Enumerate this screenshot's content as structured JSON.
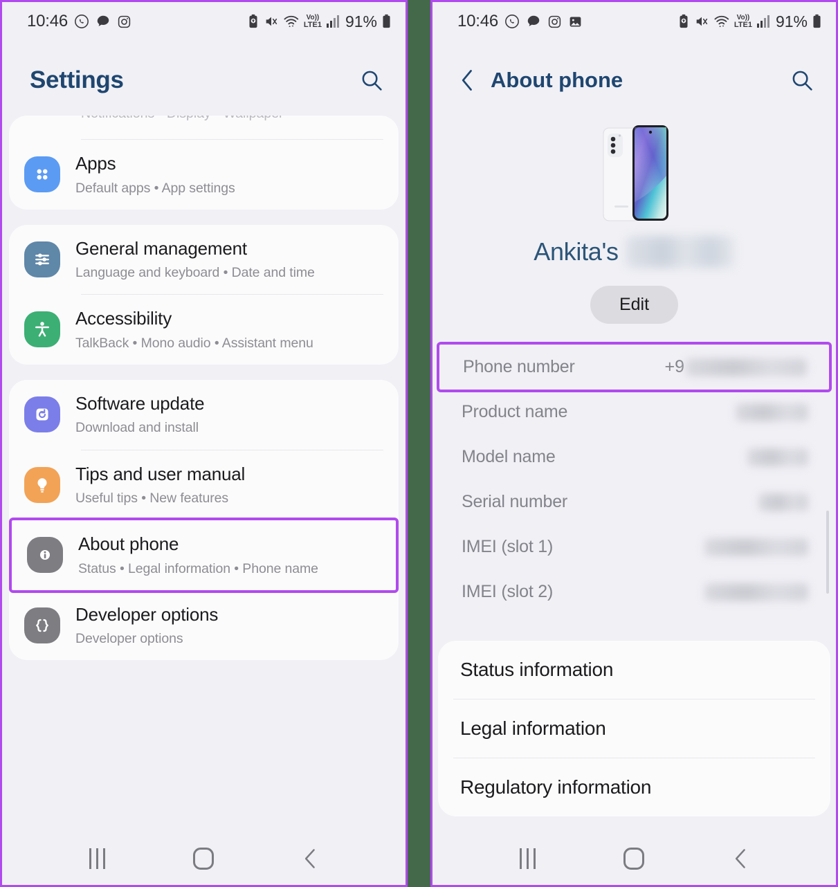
{
  "statusbar": {
    "time": "10:46",
    "battery_percent": "91%",
    "left_icons": [
      "whatsapp-icon",
      "chat-bubble-icon",
      "instagram-icon"
    ],
    "left_icons_right_panel": [
      "whatsapp-icon",
      "chat-bubble-icon",
      "instagram-icon",
      "gallery-icon"
    ],
    "right_icons": [
      "battery-protect-icon",
      "mute-vibrate-icon",
      "wifi-icon",
      "volte-lte1-icon",
      "signal-bars-icon",
      "battery-icon"
    ],
    "network_label_top": "Vo))",
    "network_label_bottom": "LTE1"
  },
  "colors": {
    "highlight": "#b14aee",
    "divider": "#44694a",
    "title": "#1f4670",
    "apps_icon": "#5b9bf3",
    "general_icon": "#5f87a8",
    "accessibility_icon": "#3caf74",
    "software_icon": "#7b7ee8",
    "tips_icon": "#f2a356",
    "about_icon": "#7d7d82",
    "developer_icon": "#7d7d82"
  },
  "left_panel": {
    "title": "Settings",
    "search_icon": "search-icon",
    "clipped_text": "Notifications • Display • Wallpaper",
    "groups": [
      {
        "items": [
          {
            "label": "Apps",
            "sub": "Default apps  •  App settings",
            "icon": "apps-grid-icon",
            "icon_color": "#5b9bf3",
            "highlighted": false
          }
        ]
      },
      {
        "items": [
          {
            "label": "General management",
            "sub": "Language and keyboard  •  Date and time",
            "icon": "sliders-icon",
            "icon_color": "#5f87a8",
            "highlighted": false
          },
          {
            "label": "Accessibility",
            "sub": "TalkBack  •  Mono audio  •  Assistant menu",
            "icon": "accessibility-person-icon",
            "icon_color": "#3caf74",
            "highlighted": false
          }
        ]
      },
      {
        "items": [
          {
            "label": "Software update",
            "sub": "Download and install",
            "icon": "software-update-icon",
            "icon_color": "#7b7ee8",
            "highlighted": false
          },
          {
            "label": "Tips and user manual",
            "sub": "Useful tips  •  New features",
            "icon": "lightbulb-icon",
            "icon_color": "#f2a356",
            "highlighted": false
          },
          {
            "label": "About phone",
            "sub": "Status  •  Legal information  •  Phone name",
            "icon": "info-circle-icon",
            "icon_color": "#7d7d82",
            "highlighted": true
          },
          {
            "label": "Developer options",
            "sub": "Developer options",
            "icon": "curly-braces-icon",
            "icon_color": "#7d7d82",
            "highlighted": false
          }
        ]
      }
    ]
  },
  "right_panel": {
    "title": "About phone",
    "back_icon": "back-chevron-icon",
    "search_icon": "search-icon",
    "device_image": "galaxy-s21-fe-phone-image",
    "device_name": "Ankita's",
    "device_name_redacted": true,
    "edit_label": "Edit",
    "info_rows": [
      {
        "key": "Phone number",
        "value": "+9",
        "redacted": true,
        "highlighted": true
      },
      {
        "key": "Product name",
        "value": "",
        "redacted": true,
        "highlighted": false
      },
      {
        "key": "Model name",
        "value": "",
        "redacted": true,
        "highlighted": false
      },
      {
        "key": "Serial number",
        "value": "",
        "redacted": true,
        "highlighted": false
      },
      {
        "key": "IMEI (slot 1)",
        "value": "",
        "redacted": true,
        "highlighted": false
      },
      {
        "key": "IMEI (slot 2)",
        "value": "",
        "redacted": true,
        "highlighted": false
      }
    ],
    "links": [
      {
        "label": "Status information"
      },
      {
        "label": "Legal information"
      },
      {
        "label": "Regulatory information"
      }
    ]
  },
  "navbar": {
    "recents_label": "recents-icon",
    "home_label": "home-icon",
    "back_label": "back-icon"
  }
}
